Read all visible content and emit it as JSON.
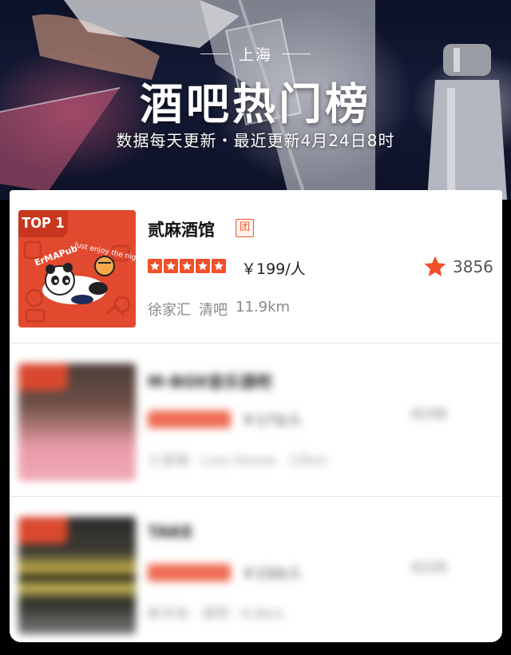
{
  "hero": {
    "city": "上海",
    "title": "酒吧热门榜",
    "subtitle": "数据每天更新・最近更新4月24日8时"
  },
  "items": [
    {
      "rank_badge": "TOP 1",
      "logo_text": "ErMAPub · Just enjoy the night",
      "name": "贰麻酒馆",
      "tag": "团",
      "rating": 5,
      "price": "￥199/人",
      "favorites": "3856",
      "district": "徐家汇",
      "category": "清吧",
      "distance": "11.9km"
    },
    {
      "rank_badge": "TOP 2",
      "name": "M-BOX音乐酒吧",
      "price": "￥173/人",
      "favorites": "4248",
      "meta": "七宝镇 · Live House · 13km",
      "blurred": true
    },
    {
      "rank_badge": "TOP 3",
      "name": "TAKE",
      "price": "￥150/人",
      "favorites": "4226",
      "meta": "新天地 · 清吧 · 8.6km",
      "blurred": true
    }
  ],
  "colors": {
    "accent": "#f0502a",
    "badge": "#c9361f",
    "text_primary": "#111111",
    "text_secondary": "#888888"
  },
  "icons": {
    "star": "star-icon",
    "favorite": "favorite-star-icon",
    "group_buy": "group-buy-badge"
  }
}
